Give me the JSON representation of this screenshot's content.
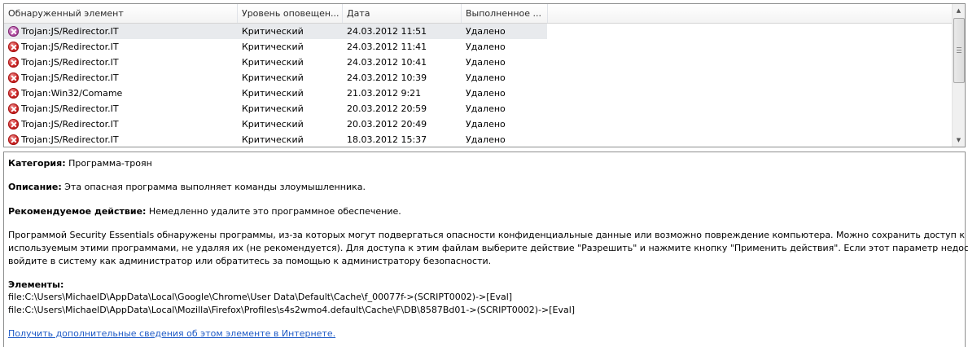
{
  "columns": [
    "Обнаруженный элемент",
    "Уровень оповещен...",
    "Дата",
    "Выполненное ..."
  ],
  "rows": [
    {
      "name": "Trojan:JS/Redirector.IT",
      "level": "Критический",
      "date": "24.03.2012 11:51",
      "action": "Удалено"
    },
    {
      "name": "Trojan:JS/Redirector.IT",
      "level": "Критический",
      "date": "24.03.2012 11:41",
      "action": "Удалено"
    },
    {
      "name": "Trojan:JS/Redirector.IT",
      "level": "Критический",
      "date": "24.03.2012 10:41",
      "action": "Удалено"
    },
    {
      "name": "Trojan:JS/Redirector.IT",
      "level": "Критический",
      "date": "24.03.2012 10:39",
      "action": "Удалено"
    },
    {
      "name": "Trojan:Win32/Comame",
      "level": "Критический",
      "date": "21.03.2012 9:21",
      "action": "Удалено"
    },
    {
      "name": "Trojan:JS/Redirector.IT",
      "level": "Критический",
      "date": "20.03.2012 20:59",
      "action": "Удалено"
    },
    {
      "name": "Trojan:JS/Redirector.IT",
      "level": "Критический",
      "date": "20.03.2012 20:49",
      "action": "Удалено"
    },
    {
      "name": "Trojan:JS/Redirector.IT",
      "level": "Критический",
      "date": "18.03.2012 15:37",
      "action": "Удалено"
    }
  ],
  "details": {
    "category_label": "Категория:",
    "category_value": " Программа-троян",
    "description_label": "Описание:",
    "description_value": " Эта опасная программа выполняет команды злоумышленника.",
    "recommend_label": "Рекомендуемое действие:",
    "recommend_value": " Немедленно удалите это программное обеспечение.",
    "paragraph_1": "Программой Security Essentials обнаружены программы, из-за которых могут подвергаться опасности конфиденциальные данные или возможно повреждение компьютера. Можно сохранить доступ к файлам,",
    "paragraph_2": "используемым этими программами, не удаляя их (не рекомендуется). Для доступа к этим файлам выберите действие \"Разрешить\" и нажмите кнопку \"Применить действия\". Если этот параметр недоступен,",
    "paragraph_3": "войдите в систему как администратор или обратитесь за помощью к администратору безопасности.",
    "elements_label": "Элементы:",
    "element_1": "file:C:\\Users\\MichaelD\\AppData\\Local\\Google\\Chrome\\User Data\\Default\\Cache\\f_00077f->(SCRIPT0002)->[Eval]",
    "element_2": "file:C:\\Users\\MichaelD\\AppData\\Local\\Mozilla\\Firefox\\Profiles\\s4s2wmo4.default\\Cache\\F\\DB\\8587Bd01->(SCRIPT0002)->[Eval]",
    "more_info_link": "Получить дополнительные сведения об этом элементе в Интернете."
  },
  "icons": {
    "threat": "threat-x-icon"
  },
  "colors": {
    "threat_red": "#c81e1e",
    "link": "#1f5bc6",
    "selected_row": "#e8eaed"
  }
}
